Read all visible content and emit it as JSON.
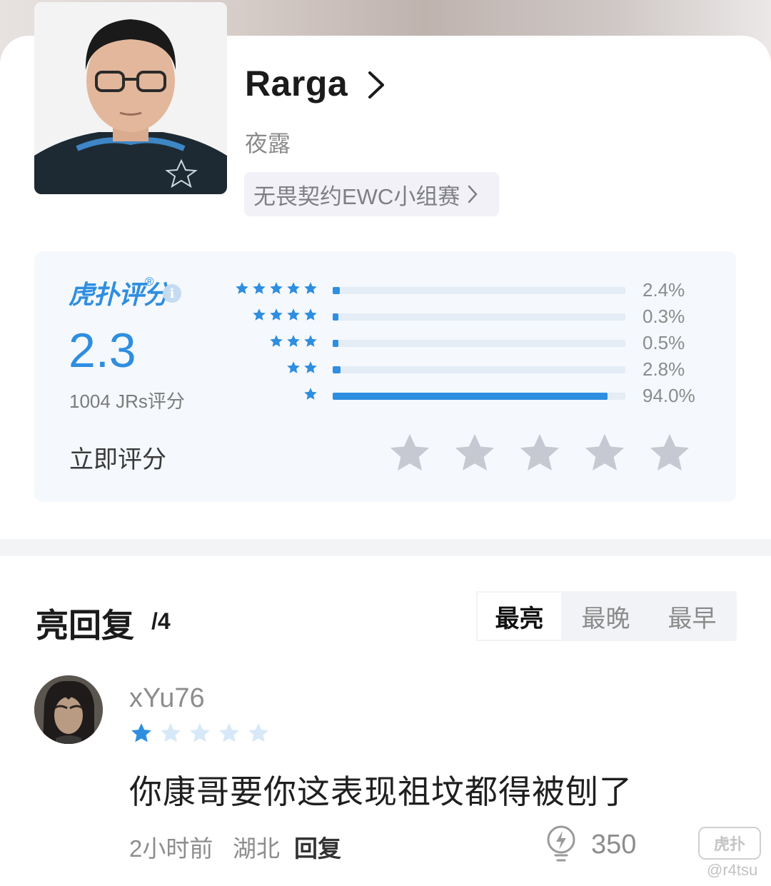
{
  "player": {
    "name": "Rarga",
    "tag": "夜露",
    "event_chip": "无畏契约EWC小组赛"
  },
  "rating": {
    "brand": "虎扑评分",
    "brand_mark": "®",
    "info_glyph": "i",
    "score": "2.3",
    "count_label": "1004 JRs评分",
    "rate_now_label": "立即评分",
    "accent_color": "#2e8ee0",
    "distribution": [
      {
        "stars": 5,
        "percent": 2.4,
        "label": "2.4%"
      },
      {
        "stars": 4,
        "percent": 0.3,
        "label": "0.3%"
      },
      {
        "stars": 3,
        "percent": 0.5,
        "label": "0.5%"
      },
      {
        "stars": 2,
        "percent": 2.8,
        "label": "2.8%"
      },
      {
        "stars": 1,
        "percent": 94.0,
        "label": "94.0%"
      }
    ],
    "user_rating_stars": 5
  },
  "replies": {
    "title": "亮回复",
    "count": "/4",
    "sort_tabs": [
      "最亮",
      "最晚",
      "最早"
    ],
    "active_tab": "最亮"
  },
  "comment": {
    "username": "xYu76",
    "stars_given": 1,
    "stars_total": 5,
    "text": "你康哥要你这表现祖坟都得被刨了",
    "time": "2小时前",
    "location": "湖北",
    "reply_label": "回复",
    "likes": "350"
  },
  "watermark": {
    "logo_text": "虎扑",
    "handle": "@r4tsu"
  }
}
